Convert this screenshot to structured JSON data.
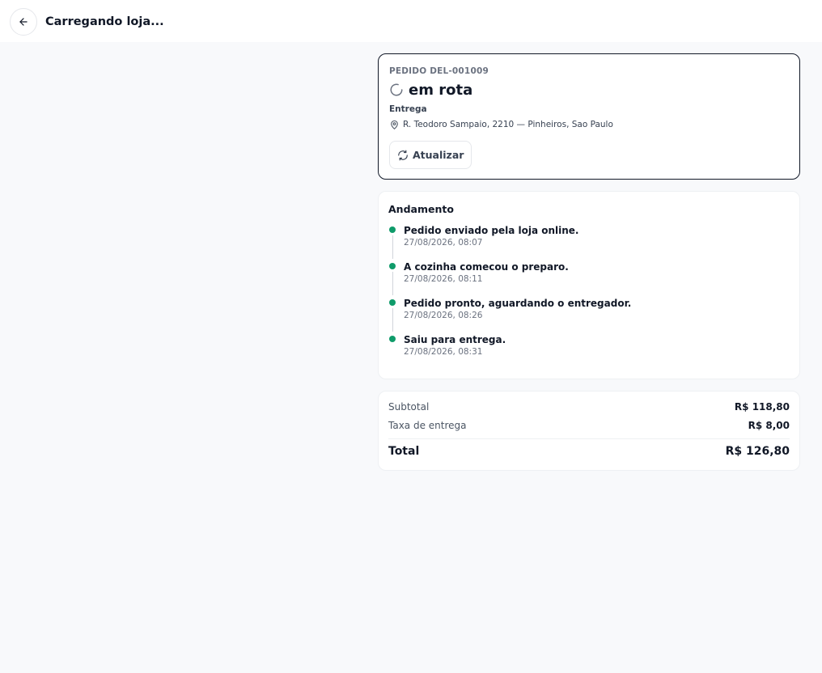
{
  "header": {
    "title": "Carregando loja...",
    "back_icon": "arrow-left-icon"
  },
  "order": {
    "id_label": "PEDIDO DEL-001009",
    "status": "em rota",
    "status_icon": "spinner-icon",
    "mode": "Entrega",
    "address": "R. Teodoro Sampaio, 2210 — Pinheiros, Sao Paulo",
    "address_icon": "map-pin-icon",
    "refresh_label": "Atualizar",
    "refresh_icon": "refresh-icon"
  },
  "timeline": {
    "title": "Andamento",
    "dot_color": "#0f9b6a",
    "items": [
      {
        "text": "Pedido enviado pela loja online.",
        "time": "27/08/2026, 08:07"
      },
      {
        "text": "A cozinha comecou o preparo.",
        "time": "27/08/2026, 08:11"
      },
      {
        "text": "Pedido pronto, aguardando o entregador.",
        "time": "27/08/2026, 08:26"
      },
      {
        "text": "Saiu para entrega.",
        "time": "27/08/2026, 08:31"
      }
    ]
  },
  "totals": {
    "subtotal_label": "Subtotal",
    "subtotal_value": "R$ 118,80",
    "delivery_label": "Taxa de entrega",
    "delivery_value": "R$ 8,00",
    "total_label": "Total",
    "total_value": "R$ 126,80"
  }
}
